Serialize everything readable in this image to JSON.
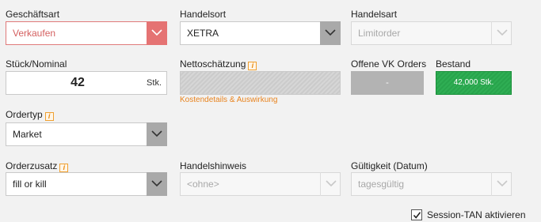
{
  "geschaeftsart": {
    "label": "Geschäftsart",
    "value": "Verkaufen"
  },
  "handelsort": {
    "label": "Handelsort",
    "value": "XETRA"
  },
  "handelsart": {
    "label": "Handelsart",
    "value": "Limitorder"
  },
  "stueck": {
    "label": "Stück/Nominal",
    "value": "42",
    "unit": "Stk."
  },
  "nettoschaetzung": {
    "label": "Nettoschätzung",
    "info": "i",
    "link": "Kostendetails & Auswirkung"
  },
  "offene_orders": {
    "label": "Offene VK Orders",
    "value": "-"
  },
  "bestand": {
    "label": "Bestand",
    "value": "42,000 Stk."
  },
  "ordertyp": {
    "label": "Ordertyp",
    "info": "i",
    "value": "Market"
  },
  "orderzusatz": {
    "label": "Orderzusatz",
    "info": "i",
    "value": "fill or kill"
  },
  "handelshinweis": {
    "label": "Handelshinweis",
    "value": "<ohne>"
  },
  "gueltigkeit": {
    "label": "Gültigkeit (Datum)",
    "value": "tagesgültig"
  },
  "session_tan": {
    "label": "Session-TAN aktivieren",
    "checked": true
  },
  "colors": {
    "error": "#e57373",
    "accent": "#e8831e",
    "success": "#2fae54",
    "dropdown_arrow": "#a9a9a9"
  },
  "icons": [
    "chevron-down-icon",
    "info-icon",
    "checkmark-icon"
  ]
}
